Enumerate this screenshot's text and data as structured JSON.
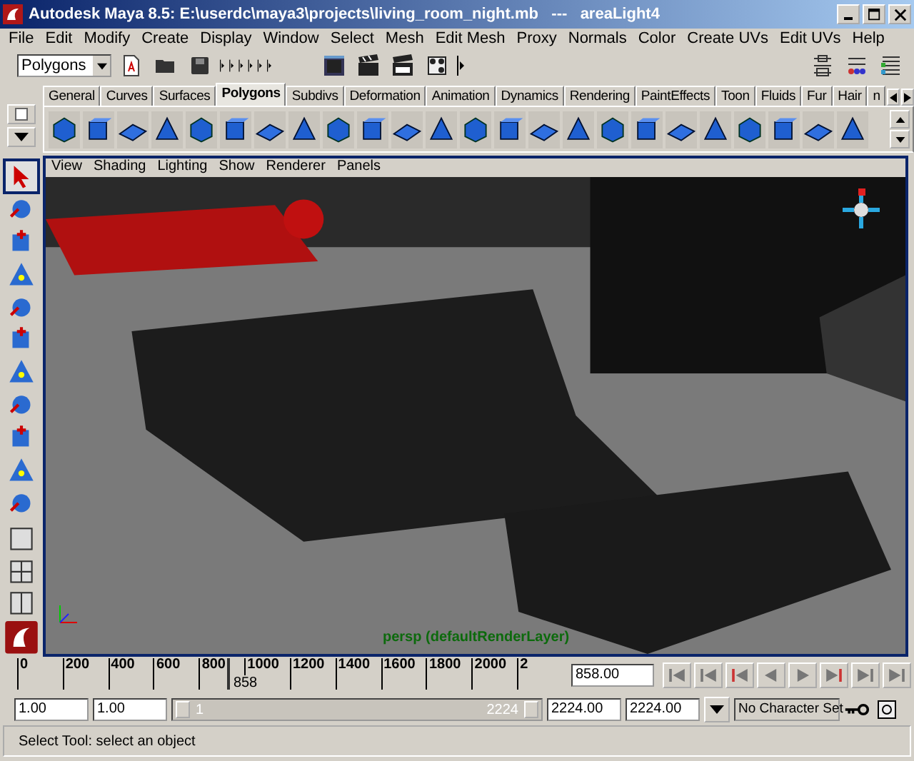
{
  "window": {
    "title": "Autodesk Maya 8.5: E:\\userdc\\maya3\\projects\\living_room_night.mb   ---   areaLight4"
  },
  "menus": [
    "File",
    "Edit",
    "Modify",
    "Create",
    "Display",
    "Window",
    "Select",
    "Mesh",
    "Edit Mesh",
    "Proxy",
    "Normals",
    "Color",
    "Create UVs",
    "Edit UVs",
    "Help"
  ],
  "status_line": {
    "menu_set": "Polygons"
  },
  "shelf_tabs": [
    {
      "label": "General",
      "selected": false
    },
    {
      "label": "Curves",
      "selected": false
    },
    {
      "label": "Surfaces",
      "selected": false
    },
    {
      "label": "Polygons",
      "selected": true
    },
    {
      "label": "Subdivs",
      "selected": false
    },
    {
      "label": "Deformation",
      "selected": false
    },
    {
      "label": "Animation",
      "selected": false
    },
    {
      "label": "Dynamics",
      "selected": false
    },
    {
      "label": "Rendering",
      "selected": false
    },
    {
      "label": "PaintEffects",
      "selected": false
    },
    {
      "label": "Toon",
      "selected": false
    },
    {
      "label": "Fluids",
      "selected": false
    },
    {
      "label": "Fur",
      "selected": false
    },
    {
      "label": "Hair",
      "selected": false
    },
    {
      "label": "n",
      "selected": false
    }
  ],
  "panel_menus": [
    "View",
    "Shading",
    "Lighting",
    "Show",
    "Renderer",
    "Panels"
  ],
  "viewport": {
    "camera_label": "persp (defaultRenderLayer)"
  },
  "time_slider": {
    "ticks": [
      "0",
      "200",
      "400",
      "600",
      "800",
      "1000",
      "1200",
      "1400",
      "1600",
      "1800",
      "2000",
      "2"
    ],
    "current_frame": "858",
    "level": 0.386,
    "current_time": "858.00"
  },
  "range_slider": {
    "level": 1,
    "start_time": "1.00",
    "playback_start": "1.00",
    "range_start": "1",
    "range_end": "2224",
    "playback_end": "2224.00",
    "end_time": "2224.00",
    "character_set": "No Character Set"
  },
  "help_line": "Select Tool: select an object"
}
